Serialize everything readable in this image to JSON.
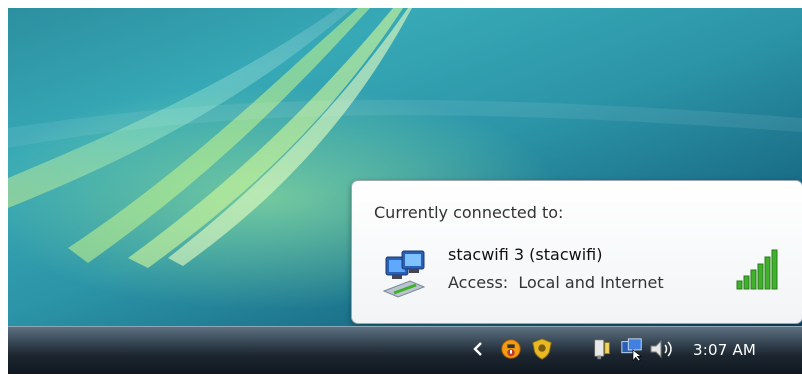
{
  "popup": {
    "title": "Currently connected to:",
    "network_name": "stacwifi  3 (stacwifi)",
    "access": "Access:  Local and Internet",
    "signal_icon": "signal-strength-full-icon",
    "network_icon": "wireless-network-icon"
  },
  "taskbar": {
    "time": "3:07 AM",
    "tray_icons": [
      "show-hidden-icons-chevron",
      "security-alert-icon",
      "windows-defender-shield-icon",
      "power-plug-icon",
      "network-connection-icon",
      "volume-icon"
    ]
  },
  "colors": {
    "desktop_teal": "#2c95a8",
    "taskbar_dark": "#1c2630",
    "signal_green": "#3fb12a",
    "alert_orange": "#f39c12"
  }
}
